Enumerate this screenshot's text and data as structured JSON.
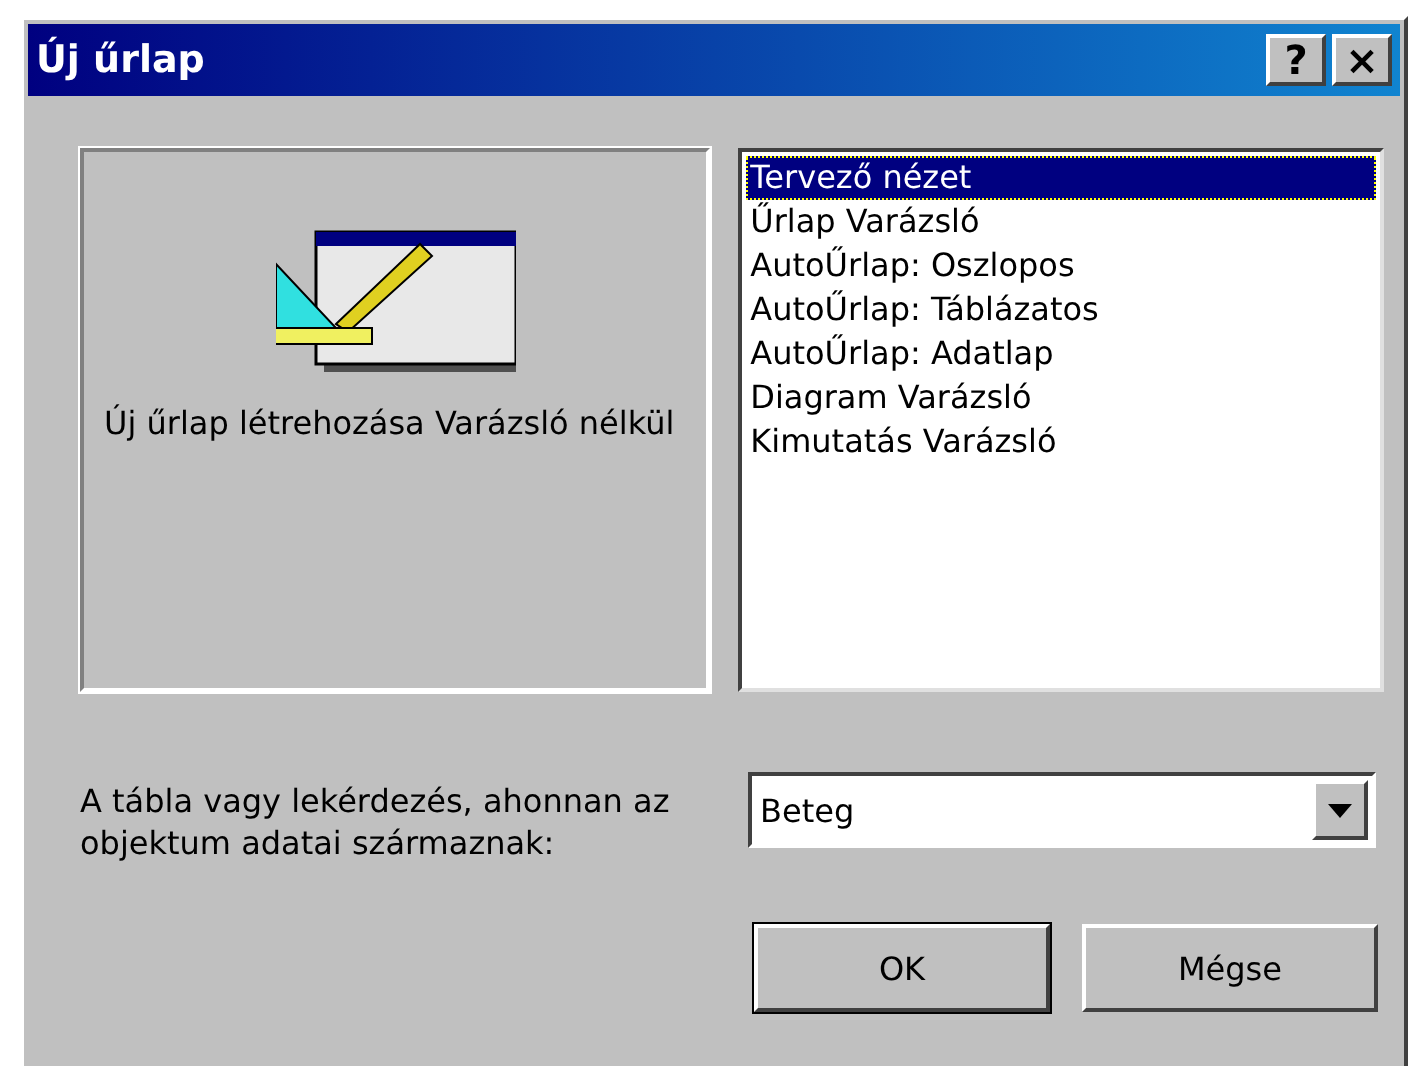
{
  "window": {
    "title": "Új űrlap",
    "title_buttons": [
      "?",
      "×"
    ]
  },
  "preview": {
    "description": "Új űrlap létrehozása Varázsló nélkül"
  },
  "options": [
    {
      "label": "Tervező nézet",
      "selected": true
    },
    {
      "label": "Űrlap Varázsló",
      "selected": false
    },
    {
      "label": "AutoŰrlap: Oszlopos",
      "selected": false
    },
    {
      "label": "AutoŰrlap: Táblázatos",
      "selected": false
    },
    {
      "label": "AutoŰrlap: Adatlap",
      "selected": false
    },
    {
      "label": "Diagram Varázsló",
      "selected": false
    },
    {
      "label": "Kimutatás Varázsló",
      "selected": false
    }
  ],
  "source": {
    "label": "A tábla vagy lekérdezés, ahonnan az objektum adatai származnak:",
    "value": "Beteg"
  },
  "buttons": [
    "OK",
    "Mégse"
  ]
}
